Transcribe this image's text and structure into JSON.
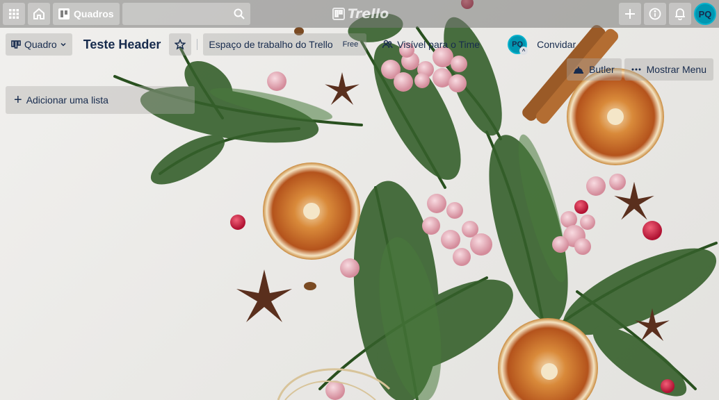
{
  "topbar": {
    "apps_icon": "grid-icon",
    "home_icon": "home-icon",
    "boards_label": "Quadros",
    "search_icon": "search-icon",
    "logo_text": "Trello",
    "create_icon": "plus-icon",
    "info_icon": "info-icon",
    "notifications_icon": "bell-icon",
    "avatar_initials": "PQ"
  },
  "board_header": {
    "view_switcher_label": "Quadro",
    "board_title": "Teste Header",
    "workspace_label": "Espaço de trabalho do Trello",
    "workspace_badge": "Free",
    "visibility_label": "Visível para o Time",
    "member_initials": "PQ",
    "invite_label": "Convidar"
  },
  "right_menu": {
    "butler_label": "Butler",
    "show_menu_label": "Mostrar Menu"
  },
  "lists": {
    "add_list_label": "Adicionar uma lista"
  },
  "colors": {
    "avatar_bg": "#0097b2",
    "text_dark": "#172b4d",
    "topbar_overlay": "rgba(120,120,118,0.55)"
  }
}
